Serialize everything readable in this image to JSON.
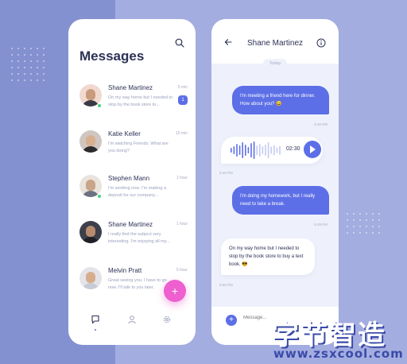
{
  "inbox": {
    "title": "Messages",
    "conversations": [
      {
        "name": "Shane Martinez",
        "time": "5 min",
        "preview": "On my way home but I needed to stop by the book store to...",
        "unread": "1",
        "online": true
      },
      {
        "name": "Katie Keller",
        "time": "15 min",
        "preview": "I'm watching Friends. What are you doing?"
      },
      {
        "name": "Stephen Mann",
        "time": "1 hour",
        "preview": "I'm working now. I'm making a deposit for our company..."
      },
      {
        "name": "Shane Martinez",
        "time": "1 hour",
        "preview": "I really find the subject very interesting. I'm enjoying all my..."
      },
      {
        "name": "Melvin Pratt",
        "time": "5 hour",
        "preview": "Great seeing you. I have to go now. I'll talk to you later."
      }
    ],
    "fab_label": "+"
  },
  "chat": {
    "contact_name": "Shane Martinez",
    "day_label": "Today",
    "messages": [
      {
        "text": "I'm meeting a friend here for dinner. How about you? 😄",
        "time": "5:30 PM"
      },
      {
        "voice_duration": "02:30",
        "time": "5:46 PM"
      },
      {
        "text": "I'm doing my homework, but I really need to take a break.",
        "time": "5:48 PM"
      },
      {
        "text": "On my way home but I needed to stop by the book store to buy a text book. 😎",
        "time": "5:56 PM"
      }
    ],
    "input_placeholder": "Message...",
    "add_label": "+"
  },
  "watermark": {
    "chinese": "字节智造",
    "url": "www.zsxcool.com"
  },
  "colors": {
    "accent": "#5c6fe6",
    "fab": "#ee5fcf",
    "online": "#4cd07d",
    "background": "#8f9bd6"
  },
  "icons": [
    "search-icon",
    "chat-icon",
    "profile-icon",
    "settings-icon",
    "back-arrow-icon",
    "info-icon",
    "play-icon",
    "plus-icon"
  ]
}
